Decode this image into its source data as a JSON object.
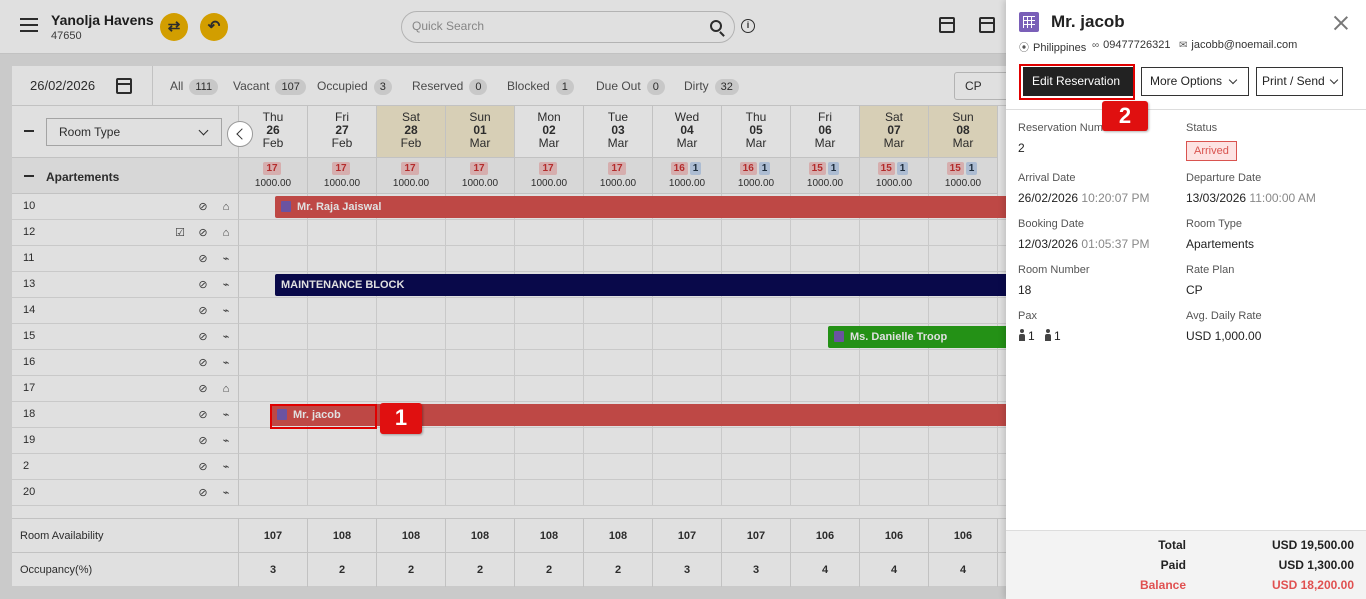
{
  "header": {
    "hotel_name": "Yanolja Havens",
    "hotel_id": "47650",
    "search_placeholder": "Quick Search"
  },
  "toolbar": {
    "date": "26/02/2026",
    "filters": [
      {
        "label": "All",
        "count": "111"
      },
      {
        "label": "Vacant",
        "count": "107"
      },
      {
        "label": "Occupied",
        "count": "3"
      },
      {
        "label": "Reserved",
        "count": "0"
      },
      {
        "label": "Blocked",
        "count": "1"
      },
      {
        "label": "Due Out",
        "count": "0"
      },
      {
        "label": "Dirty",
        "count": "32"
      }
    ],
    "rate_plan": "CP"
  },
  "grid": {
    "room_type_select": "Room Type",
    "section": "Apartements",
    "days": [
      {
        "dow": "Thu",
        "day": "26",
        "mon": "Feb",
        "weekend": false,
        "red": "17",
        "blue": "",
        "rate": "1000.00"
      },
      {
        "dow": "Fri",
        "day": "27",
        "mon": "Feb",
        "weekend": false,
        "red": "17",
        "blue": "",
        "rate": "1000.00"
      },
      {
        "dow": "Sat",
        "day": "28",
        "mon": "Feb",
        "weekend": true,
        "red": "17",
        "blue": "",
        "rate": "1000.00"
      },
      {
        "dow": "Sun",
        "day": "01",
        "mon": "Mar",
        "weekend": true,
        "red": "17",
        "blue": "",
        "rate": "1000.00"
      },
      {
        "dow": "Mon",
        "day": "02",
        "mon": "Mar",
        "weekend": false,
        "red": "17",
        "blue": "",
        "rate": "1000.00"
      },
      {
        "dow": "Tue",
        "day": "03",
        "mon": "Mar",
        "weekend": false,
        "red": "17",
        "blue": "",
        "rate": "1000.00"
      },
      {
        "dow": "Wed",
        "day": "04",
        "mon": "Mar",
        "weekend": false,
        "red": "16",
        "blue": "1",
        "rate": "1000.00"
      },
      {
        "dow": "Thu",
        "day": "05",
        "mon": "Mar",
        "weekend": false,
        "red": "16",
        "blue": "1",
        "rate": "1000.00"
      },
      {
        "dow": "Fri",
        "day": "06",
        "mon": "Mar",
        "weekend": false,
        "red": "15",
        "blue": "1",
        "rate": "1000.00"
      },
      {
        "dow": "Sat",
        "day": "07",
        "mon": "Mar",
        "weekend": true,
        "red": "15",
        "blue": "1",
        "rate": "1000.00"
      },
      {
        "dow": "Sun",
        "day": "08",
        "mon": "Mar",
        "weekend": true,
        "red": "15",
        "blue": "1",
        "rate": "1000.00"
      }
    ],
    "rooms": [
      "10",
      "12",
      "11",
      "13",
      "14",
      "15",
      "16",
      "17",
      "18",
      "19",
      "2",
      "20"
    ],
    "bookings": {
      "raja": "Mr. Raja Jaiswal",
      "maintenance": "MAINTENANCE BLOCK",
      "danielle": "Ms. Danielle Troop",
      "jacob": "Mr. jacob"
    },
    "availability_label": "Room Availability",
    "availability": [
      "107",
      "108",
      "108",
      "108",
      "108",
      "108",
      "107",
      "107",
      "106",
      "106",
      "106"
    ],
    "occupancy_label": "Occupancy(%)",
    "occupancy": [
      "3",
      "2",
      "2",
      "2",
      "2",
      "2",
      "3",
      "3",
      "4",
      "4",
      "4"
    ]
  },
  "markers": {
    "one": "1",
    "two": "2"
  },
  "panel": {
    "guest_name": "Mr. jacob",
    "country": "Philippines",
    "phone": "09477726321",
    "email": "jacobb@noemail.com",
    "buttons": {
      "edit": "Edit Reservation",
      "more": "More Options",
      "print": "Print / Send"
    },
    "fields": {
      "res_number_label": "Reservation Number",
      "res_number": "2",
      "status_label": "Status",
      "status": "Arrived",
      "arrival_label": "Arrival Date",
      "arrival_date": "26/02/2026",
      "arrival_time": "10:20:07 PM",
      "departure_label": "Departure Date",
      "departure_date": "13/03/2026",
      "departure_time": "11:00:00 AM",
      "booking_label": "Booking Date",
      "booking_date": "12/03/2026",
      "booking_time": "01:05:37 PM",
      "room_type_label": "Room Type",
      "room_type": "Apartements",
      "room_number_label": "Room Number",
      "room_number": "18",
      "rate_plan_label": "Rate Plan",
      "rate_plan": "CP",
      "pax_label": "Pax",
      "pax_adults": "1",
      "pax_children": "1",
      "adr_label": "Avg. Daily Rate",
      "adr": "USD 1,000.00"
    },
    "totals": {
      "total_label": "Total",
      "total": "USD 19,500.00",
      "paid_label": "Paid",
      "paid": "USD 1,300.00",
      "balance_label": "Balance",
      "balance": "USD 18,200.00"
    }
  }
}
